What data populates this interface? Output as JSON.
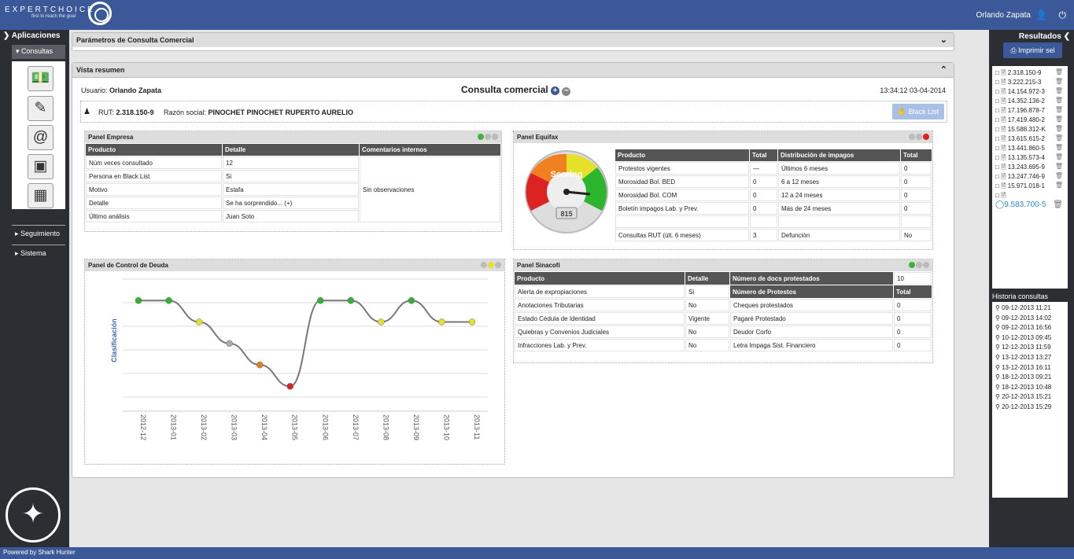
{
  "topbar": {
    "brand": "EXPERTCHOICE",
    "tagline": "first to reach the goal",
    "user_name": "Orlando Zapata",
    "user_icon": "user-icon",
    "power_icon": "power-icon"
  },
  "sidebar": {
    "aplicaciones": "Aplicaciones",
    "consultas": "Consultas",
    "icons": [
      "money-icon",
      "edit-form-icon",
      "contact-email-icon",
      "wallet-icon",
      "calendar-icon"
    ],
    "seguimiento": "Seguimiento",
    "sistema": "Sistema"
  },
  "footer": {
    "text": "Powered by Shark Hunter"
  },
  "parametros": {
    "title": "Parámetros de Consulta Comercial"
  },
  "resumen": {
    "title": "Vista resumen",
    "usuario_label": "Usuario:",
    "usuario_value": "Orlando Zapata",
    "heading": "Consulta comercial",
    "timestamp": "13:34:12 03-04-2014",
    "rut_label": "RUT:",
    "rut_value": "2.318.150-9",
    "razon_label": "Razón social:",
    "razon_value": "PINOCHET PINOCHET RUPERTO AURELIO",
    "black_list": "Black List"
  },
  "empresa": {
    "title": "Panel Empresa",
    "headers": [
      "Producto",
      "Detalle",
      "Comentarios internos"
    ],
    "rows": [
      [
        "Núm veces consultado",
        "12"
      ],
      [
        "Persona en Black List",
        "Si"
      ],
      [
        "Motivo",
        "Estafa"
      ],
      [
        "Detalle",
        "Se ha sorprendido... (+)"
      ],
      [
        "Último análisis",
        "Juan Soto"
      ]
    ],
    "comment": "Sin observaciones"
  },
  "equifax": {
    "title": "Panel Equifax",
    "gauge_label": "Scoring",
    "gauge_value": "815",
    "headers": [
      "Producto",
      "Total",
      "Distribución de impagos",
      "Total"
    ],
    "rows": [
      [
        "Protestos vigentes",
        "—",
        "Últimos 6 meses",
        "0"
      ],
      [
        "Morosidad Bol. BED",
        "0",
        "6 a 12 meses",
        "0"
      ],
      [
        "Morosidad Bol. COM",
        "0",
        "12 a 24 meses",
        "0"
      ],
      [
        "Boletín impagos Lab. y Prev.",
        "0",
        "Más de 24 meses",
        "0"
      ],
      [
        "",
        "",
        "",
        ""
      ],
      [
        "Consultas RUT (últ. 6 meses)",
        "3",
        "Defunción",
        "No"
      ]
    ]
  },
  "deuda": {
    "title": "Panel de Control de Deuda"
  },
  "chart_data": {
    "type": "line",
    "title": "",
    "ylabel": "Clasificación",
    "xlabel": "",
    "categories": [
      "2012-12",
      "2013-01",
      "2013-02",
      "2013-03",
      "2013-04",
      "2013-05",
      "2013-06",
      "2013-07",
      "2013-08",
      "2013-09",
      "2013-10",
      "2013-11"
    ],
    "values": [
      5,
      5,
      4,
      3,
      2,
      1,
      5,
      5,
      4,
      5,
      4,
      4
    ],
    "point_colors": [
      "#2db52d",
      "#2db52d",
      "#e6e02a",
      "#aaaaaa",
      "#e08020",
      "#dd2222",
      "#2db52d",
      "#2db52d",
      "#e6e02a",
      "#2db52d",
      "#e6e02a",
      "#e6e02a"
    ],
    "ylim": [
      0.5,
      6
    ],
    "grid": true
  },
  "sinacofi": {
    "title": "Panel Sinacofi",
    "headers": [
      "Producto",
      "Detalle"
    ],
    "rows": [
      [
        "Alerta de expropiaciones",
        "Si"
      ],
      [
        "Anotaciones Tributarias",
        "No"
      ],
      [
        "Estado Cédula de Identidad",
        "Vigente"
      ],
      [
        "Quiebras y Convenios Judiciales",
        "No"
      ],
      [
        "Infracciones Lab. y Prev.",
        "No"
      ]
    ],
    "docs_label": "Número de docs protestados",
    "docs_value": "10",
    "prot_headers": [
      "Número de Protestos",
      "Total"
    ],
    "prot_rows": [
      [
        "Cheques protestados",
        "0"
      ],
      [
        "Pagaré Protestado",
        "0"
      ],
      [
        "Deudor Corfo",
        "0"
      ],
      [
        "Letra Impaga Sist. Financiero",
        "0"
      ]
    ]
  },
  "resultados": {
    "title": "Resultados",
    "print": "Imprimir sel",
    "items": [
      "2.318.150-9",
      "3.222.215-3",
      "14.154.972-3",
      "14.352.136-2",
      "17.196.878-7",
      "17.419.480-2",
      "15.588.312-K",
      "13.615.615-2",
      "13.441.860-5",
      "13.135.573-4",
      "13.243.695-9",
      "13.247.746-9",
      "15.971.018-1",
      ""
    ],
    "selected": "9.583.700-5"
  },
  "historia": {
    "title": "Historia consultas",
    "items": [
      "09-12-2013 11:21",
      "09-12-2013 14:02",
      "09-12-2013 16:56",
      "10-12-2013 09:45",
      "12-12-2013 11:59",
      "13-12-2013 13:27",
      "13-12-2013 16:11",
      "18-12-2013 09:21",
      "18-12-2013 10:48",
      "20-12-2013 15:21",
      "20-12-2013 15:29"
    ]
  }
}
